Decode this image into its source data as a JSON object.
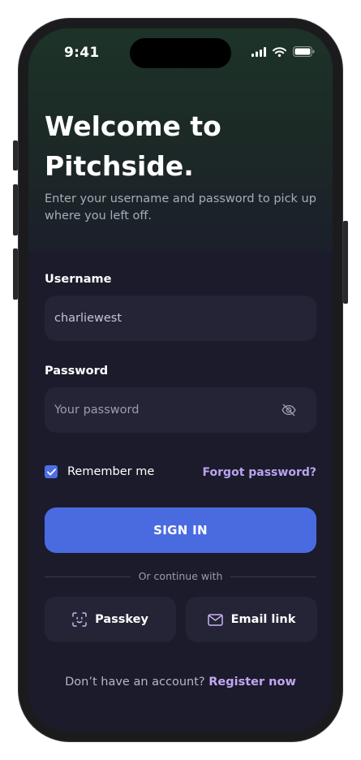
{
  "status_bar": {
    "time": "9:41"
  },
  "hero": {
    "title_line1": "Welcome to",
    "title_line2": "Pitchside.",
    "subtitle": "Enter your username and password to pick up where you left off."
  },
  "form": {
    "username": {
      "label": "Username",
      "value": "charliewest"
    },
    "password": {
      "label": "Password",
      "placeholder": "Your password",
      "visibility_icon": "eye-off-icon"
    },
    "remember_me": {
      "label": "Remember me",
      "checked": true
    },
    "forgot_password": "Forgot password?",
    "sign_in_label": "SIGN IN"
  },
  "alt_login": {
    "divider_text": "Or continue with",
    "options": [
      {
        "label": "Passkey",
        "icon": "face-scan-icon"
      },
      {
        "label": "Email link",
        "icon": "mail-icon"
      }
    ]
  },
  "footer": {
    "prompt": "Don’t have an account?",
    "link": "Register now"
  },
  "colors": {
    "background": "#1b1b2b",
    "field": "#242436",
    "accent": "#4a6be0",
    "link": "#b8a4ee",
    "icon": "#c9b3f2"
  }
}
